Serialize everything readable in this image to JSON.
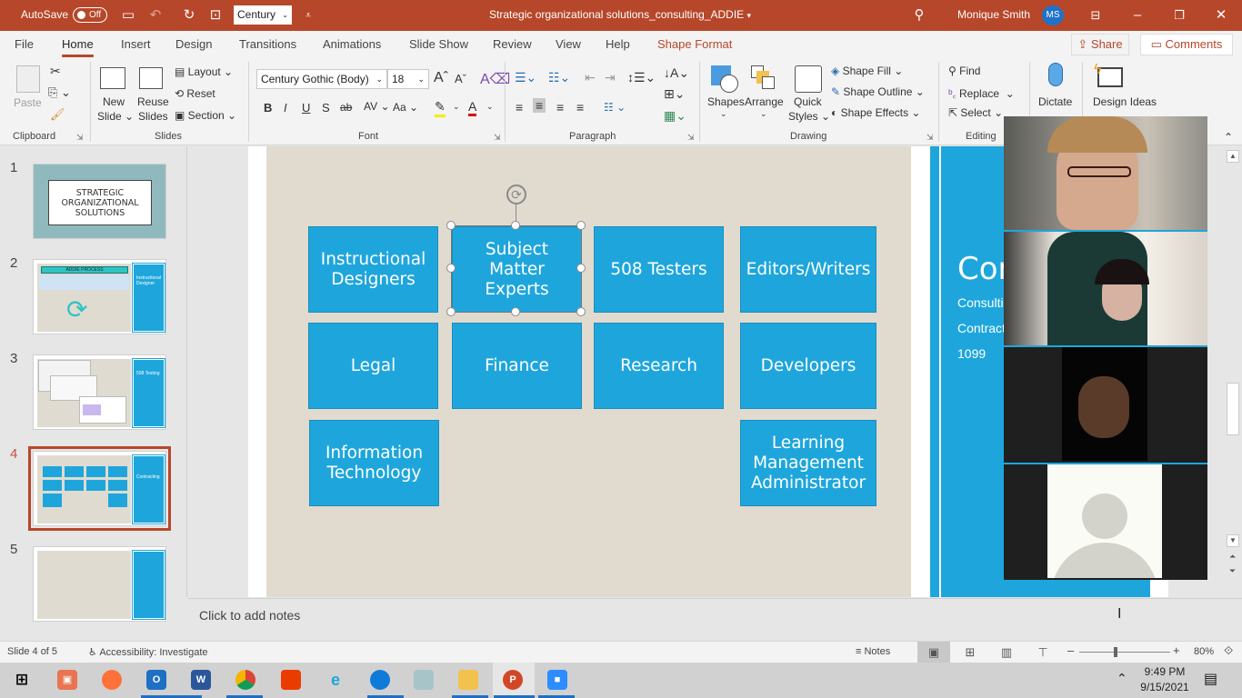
{
  "titlebar": {
    "autosave_label": "AutoSave",
    "autosave_state": "Off",
    "quick_font": "Century",
    "doc_title": "Strategic organizational solutions_consulting_ADDIE",
    "user_name": "Monique Smith",
    "user_initials": "MS"
  },
  "tabs": [
    {
      "label": "File"
    },
    {
      "label": "Home",
      "active": true
    },
    {
      "label": "Insert"
    },
    {
      "label": "Design"
    },
    {
      "label": "Transitions"
    },
    {
      "label": "Animations"
    },
    {
      "label": "Slide Show"
    },
    {
      "label": "Review"
    },
    {
      "label": "View"
    },
    {
      "label": "Help"
    },
    {
      "label": "Shape Format"
    }
  ],
  "share_label": "Share",
  "comments_label": "Comments",
  "ribbon": {
    "clipboard": {
      "label": "Clipboard",
      "paste": "Paste"
    },
    "slides": {
      "label": "Slides",
      "new_slide_1": "New",
      "new_slide_2": "Slide",
      "reuse_1": "Reuse",
      "reuse_2": "Slides",
      "layout": "Layout",
      "reset": "Reset",
      "section": "Section"
    },
    "font": {
      "label": "Font",
      "font_name": "Century Gothic (Body)",
      "font_size": "18",
      "bold": "B",
      "italic": "I",
      "underline": "U",
      "shadow": "S",
      "strike": "ab",
      "spacing": "AV",
      "case": "Aa"
    },
    "paragraph": {
      "label": "Paragraph"
    },
    "drawing": {
      "label": "Drawing",
      "shapes": "Shapes",
      "arrange": "Arrange",
      "quick_1": "Quick",
      "quick_2": "Styles",
      "shape_fill": "Shape Fill",
      "shape_outline": "Shape Outline",
      "shape_effects": "Shape Effects"
    },
    "editing": {
      "label": "Editing",
      "find": "Find",
      "replace": "Replace",
      "select": "Select"
    },
    "dictate": "Dictate",
    "design_ideas": "Design Ideas"
  },
  "thumbnails": [
    {
      "num": "1",
      "title_1": "STRATEGIC",
      "title_2": "ORGANIZATIONAL",
      "title_3": "SOLUTIONS"
    },
    {
      "num": "2",
      "header": "ADDIE PROCESS",
      "side": "Instructional Designer"
    },
    {
      "num": "3",
      "side": "508 Testing"
    },
    {
      "num": "4",
      "side": "Contracting",
      "selected": true
    },
    {
      "num": "5"
    }
  ],
  "slide": {
    "boxes": [
      {
        "label": "Instructional Designers"
      },
      {
        "label": "Subject Matter Experts",
        "selected": true
      },
      {
        "label": "508 Testers"
      },
      {
        "label": "Editors/Writers"
      },
      {
        "label": "Legal"
      },
      {
        "label": "Finance"
      },
      {
        "label": "Research"
      },
      {
        "label": "Developers"
      },
      {
        "label": "Information Technology"
      },
      {
        "label": "Learning Management Administrator"
      }
    ],
    "side_title": "Contracting",
    "side_lines": [
      "Consulting",
      "Contracting",
      "1099"
    ]
  },
  "video_participants": [
    {
      "name": "participant-1",
      "video_on": true
    },
    {
      "name": "participant-2",
      "video_on": true
    },
    {
      "name": "participant-3",
      "video_on": true
    },
    {
      "name": "participant-4",
      "video_on": false
    }
  ],
  "notes_placeholder": "Click to add notes",
  "status": {
    "slide_counter": "Slide 4 of 5",
    "accessibility": "Accessibility: Investigate",
    "notes_label": "Notes",
    "zoom_level": "80%",
    "zoom_fraction": 0.4
  },
  "taskbar": {
    "apps": [
      "start",
      "powerpoint-viewer",
      "firefox",
      "outlook",
      "word",
      "chrome",
      "office",
      "internet-explorer",
      "edge",
      "notepad",
      "file-explorer",
      "powerpoint",
      "zoom"
    ],
    "time": "9:49 PM",
    "date": "9/15/2021"
  }
}
